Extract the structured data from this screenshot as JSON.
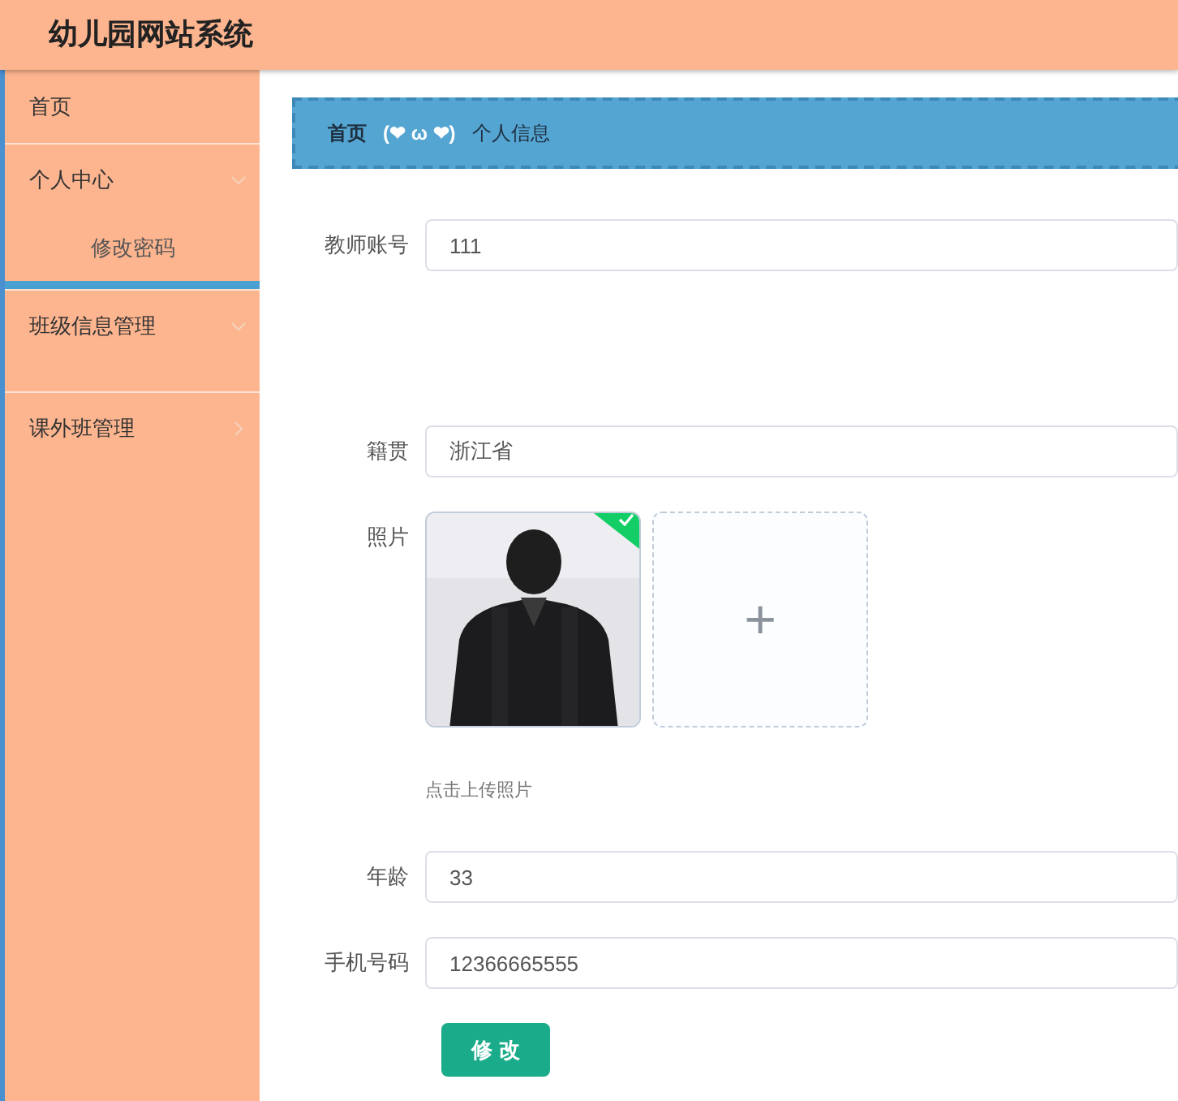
{
  "header": {
    "title": "幼儿园网站系统"
  },
  "sidebar": {
    "items": [
      {
        "label": "首页"
      },
      {
        "label": "个人中心",
        "expanded": true,
        "children": [
          {
            "label": "修改密码"
          }
        ]
      },
      {
        "label": "班级信息管理",
        "expanded": true
      },
      {
        "label": "课外班管理",
        "expanded": false
      }
    ]
  },
  "breadcrumb": {
    "home": "首页",
    "separator": "(❤ ω ❤)",
    "current": "个人信息"
  },
  "form": {
    "fields": [
      {
        "kind": "input",
        "label": "教师账号",
        "value": "111"
      },
      {
        "kind": "blank"
      },
      {
        "kind": "input",
        "label": "籍贯",
        "value": "浙江省"
      },
      {
        "kind": "upload",
        "label": "照片",
        "add": "+",
        "hint": "点击上传照片",
        "uploaded": true
      },
      {
        "kind": "input",
        "label": "年龄",
        "value": "33"
      },
      {
        "kind": "input",
        "label": "手机号码",
        "value": "12366665555"
      }
    ],
    "submit": "修 改"
  }
}
